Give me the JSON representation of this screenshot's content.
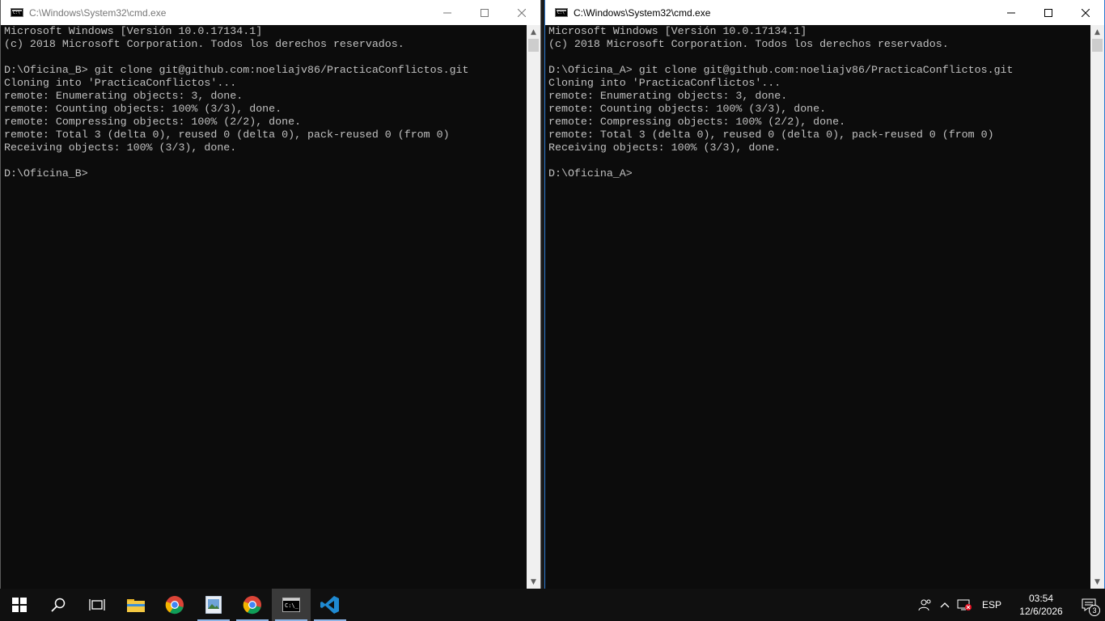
{
  "windows": [
    {
      "id": "left",
      "title": "C:\\Windows\\System32\\cmd.exe",
      "focused": false,
      "console_text": "Microsoft Windows [Versión 10.0.17134.1]\n(c) 2018 Microsoft Corporation. Todos los derechos reservados.\n\nD:\\Oficina_B> git clone git@github.com:noeliajv86/PracticaConflictos.git\nCloning into 'PracticaConflictos'...\nremote: Enumerating objects: 3, done.\nremote: Counting objects: 100% (3/3), done.\nremote: Compressing objects: 100% (2/2), done.\nremote: Total 3 (delta 0), reused 0 (delta 0), pack-reused 0 (from 0)\nReceiving objects: 100% (3/3), done.\n\nD:\\Oficina_B>"
    },
    {
      "id": "right",
      "title": "C:\\Windows\\System32\\cmd.exe",
      "focused": true,
      "console_text": "Microsoft Windows [Versión 10.0.17134.1]\n(c) 2018 Microsoft Corporation. Todos los derechos reservados.\n\nD:\\Oficina_A> git clone git@github.com:noeliajv86/PracticaConflictos.git\nCloning into 'PracticaConflictos'...\nremote: Enumerating objects: 3, done.\nremote: Counting objects: 100% (3/3), done.\nremote: Compressing objects: 100% (2/2), done.\nremote: Total 3 (delta 0), reused 0 (delta 0), pack-reused 0 (from 0)\nReceiving objects: 100% (3/3), done.\n\nD:\\Oficina_A>"
    }
  ],
  "colors": {
    "console_bg": "#0c0c0c",
    "console_text": "#c0c0c0",
    "focused_border": "#2b79d0",
    "taskbar_bg": "#101010"
  },
  "taskbar": {
    "apps": [
      {
        "icon": "windows-start-icon"
      },
      {
        "icon": "search-icon"
      },
      {
        "icon": "task-view-icon"
      },
      {
        "icon": "file-explorer-icon"
      },
      {
        "icon": "chrome-icon"
      },
      {
        "icon": "photos-icon",
        "running": true
      },
      {
        "icon": "chrome-icon",
        "running": true
      },
      {
        "icon": "cmd-icon",
        "running": true,
        "active": true
      },
      {
        "icon": "vscode-icon",
        "running": true
      }
    ],
    "tray": {
      "language": "ESP",
      "time": "03:54",
      "date": "12/6/2026",
      "notification_count": "3"
    }
  }
}
